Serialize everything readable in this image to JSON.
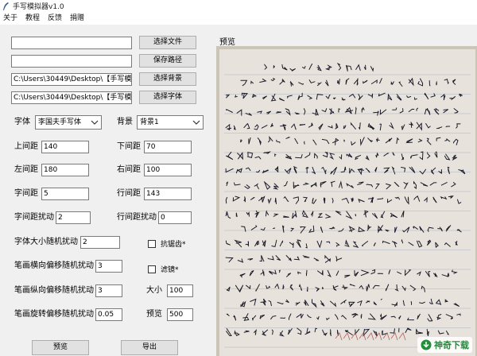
{
  "window": {
    "title": "手写模拟器v1.0"
  },
  "menu": [
    "关于",
    "教程",
    "反馈",
    "捐赠"
  ],
  "paths": {
    "text_file": "",
    "save_path": "",
    "background": "C:\\Users\\30449\\Desktop\\【手写模",
    "font": "C:\\Users\\30449\\Desktop\\【手写模"
  },
  "buttons": {
    "select_file": "选择文件",
    "save_path": "保存路径",
    "select_background": "选择背景",
    "select_font": "选择字体",
    "preview": "预览",
    "export": "导出"
  },
  "font_row": {
    "font_label": "字体",
    "font_value": "李国夫手写体",
    "bg_label": "背景",
    "bg_value": "背景1"
  },
  "params": {
    "top_margin": {
      "label": "上间距",
      "value": "140"
    },
    "bottom_margin": {
      "label": "下间距",
      "value": "70"
    },
    "left_margin": {
      "label": "左间距",
      "value": "180"
    },
    "right_margin": {
      "label": "右间距",
      "value": "100"
    },
    "char_spacing": {
      "label": "字间距",
      "value": "5"
    },
    "line_spacing": {
      "label": "行间距",
      "value": "143"
    },
    "char_spacing_jitter": {
      "label": "字间距扰动",
      "value": "2"
    },
    "line_spacing_jitter": {
      "label": "行间距扰动",
      "value": "0"
    },
    "font_size_jitter": {
      "label": "字体大小随机扰动",
      "value": "2"
    },
    "stroke_h_jitter": {
      "label": "笔画横向偏移随机扰动",
      "value": "3"
    },
    "stroke_v_jitter": {
      "label": "笔画纵向偏移随机扰动",
      "value": "3"
    },
    "stroke_rot_jitter": {
      "label": "笔画旋转偏移随机扰动",
      "value": "0.05"
    },
    "size": {
      "label": "大小",
      "value": "100"
    },
    "preview_size": {
      "label": "预览",
      "value": "500"
    }
  },
  "checks": {
    "antialias": "抗锯齿*",
    "blur": "滤镜*"
  },
  "preview_panel": {
    "label": "预览"
  },
  "watermark": {
    "text": "神奇下载",
    "brand_color": "#1f8f3a"
  }
}
